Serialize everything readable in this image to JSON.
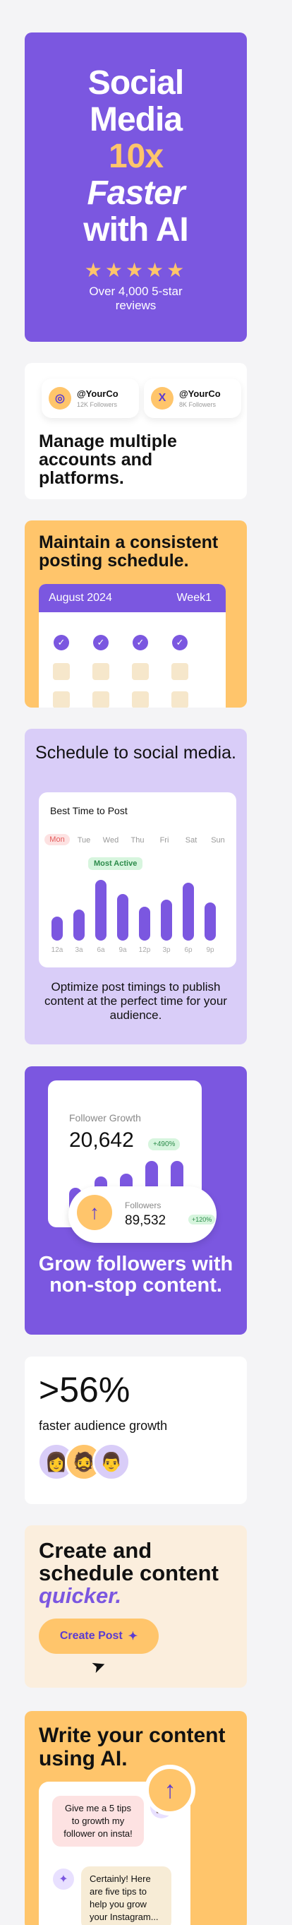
{
  "hero": {
    "line1": "Social",
    "line2": "Media",
    "accent": "10x",
    "italic": "Faster",
    "line5": "with AI",
    "stars": "★★★★★",
    "sub": "Over 4,000 5-star reviews"
  },
  "accounts": {
    "items": [
      {
        "icon": "instagram-icon",
        "glyph": "◎",
        "handle": "@YourCo",
        "followers": "12K Followers"
      },
      {
        "icon": "x-icon",
        "glyph": "X",
        "handle": "@YourCo",
        "followers": "8K Followers"
      }
    ],
    "heading": "Manage multiple accounts and platforms."
  },
  "schedule": {
    "heading": "Maintain a consistent posting schedule.",
    "month": "August 2024",
    "week": "Week1"
  },
  "social": {
    "heading": "Schedule to social media.",
    "panel_title": "Best Time to Post",
    "days": [
      "Mon",
      "Tue",
      "Wed",
      "Thu",
      "Fri",
      "Sat",
      "Sun"
    ],
    "badge": "Most Active",
    "hours": [
      "12a",
      "3a",
      "6a",
      "9a",
      "12p",
      "3p",
      "6p",
      "9p"
    ],
    "desc": "Optimize post timings to publish content at the perfect time for your audience."
  },
  "grow": {
    "title": "Follower Growth",
    "count": "20,642",
    "badge": "+490%",
    "followers_label": "Followers",
    "followers_count": "89,532",
    "followers_badge": "+120%",
    "heading": "Grow followers with non-stop content."
  },
  "stat": {
    "value": ">56%",
    "label": "faster audience growth"
  },
  "create": {
    "heading": "Create and schedule content",
    "heading_accent": "quicker.",
    "button": "Create Post"
  },
  "ai": {
    "heading": "Write your content using AI.",
    "msg_user": "Give me a 5 tips to growth my follower on insta!",
    "msg_ai": "Certainly! Here are five tips to help you grow your Instagram..."
  },
  "colors": {
    "purple": "#7b57e0",
    "yellow": "#ffc56b",
    "lavender": "#d9cdf8",
    "cream": "#fbeedd"
  }
}
